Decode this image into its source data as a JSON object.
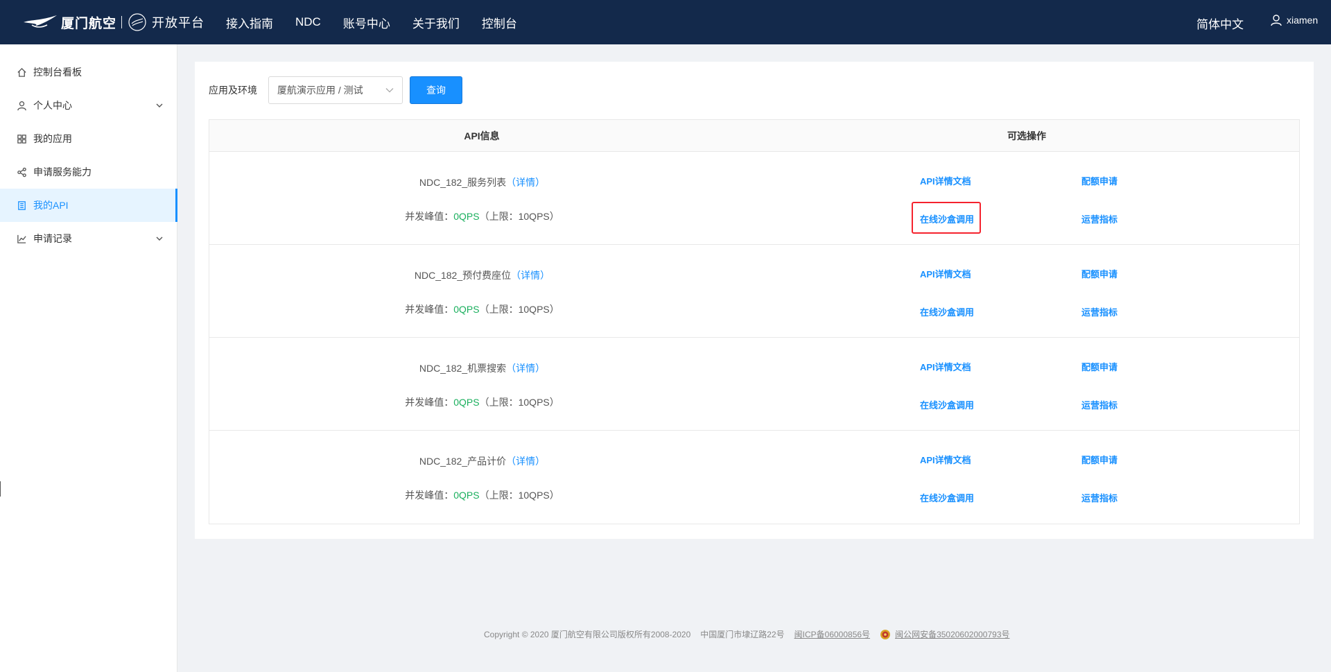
{
  "header": {
    "logo_text": "厦门航空",
    "logo_sub": "开放平台",
    "nav": [
      "接入指南",
      "NDC",
      "账号中心",
      "关于我们",
      "控制台"
    ],
    "language": "简体中文",
    "username": "xiamen"
  },
  "sidebar": {
    "items": [
      {
        "label": "控制台看板",
        "icon": "home-icon"
      },
      {
        "label": "个人中心",
        "icon": "user-icon",
        "expandable": true
      },
      {
        "label": "我的应用",
        "icon": "grid-icon"
      },
      {
        "label": "申请服务能力",
        "icon": "share-icon"
      },
      {
        "label": "我的API",
        "icon": "document-icon",
        "active": true
      },
      {
        "label": "申请记录",
        "icon": "chart-line-icon",
        "expandable": true
      }
    ]
  },
  "filter": {
    "label": "应用及环境",
    "selected": "厦航演示应用 / 测试",
    "query_button": "查询"
  },
  "table": {
    "headers": [
      "API信息",
      "可选操作"
    ],
    "detail_label": "详情",
    "qps_prefix": "并发峰值：",
    "ops": {
      "doc": "API详情文档",
      "quota": "配额申请",
      "sandbox": "在线沙盒调用",
      "metrics": "运营指标"
    },
    "rows": [
      {
        "name": "NDC_182_服务列表",
        "peak": "0QPS",
        "limit": "（上限：10QPS）"
      },
      {
        "name": "NDC_182_预付费座位",
        "peak": "0QPS",
        "limit": "（上限：10QPS）"
      },
      {
        "name": "NDC_182_机票搜索",
        "peak": "0QPS",
        "limit": "（上限：10QPS）"
      },
      {
        "name": "NDC_182_产品计价",
        "peak": "0QPS",
        "limit": "（上限：10QPS）"
      }
    ]
  },
  "footer": {
    "copyright": "Copyright © 2020 厦门航空有限公司版权所有2008-2020",
    "address": "中国厦门市埭辽路22号",
    "icp": "闽ICP备06000856号",
    "police": "闽公网安备35020602000793号"
  },
  "colors": {
    "header_bg": "#13294b",
    "accent": "#1890ff",
    "qps_green": "#1aaf5d",
    "highlight_red": "#f5222d"
  }
}
